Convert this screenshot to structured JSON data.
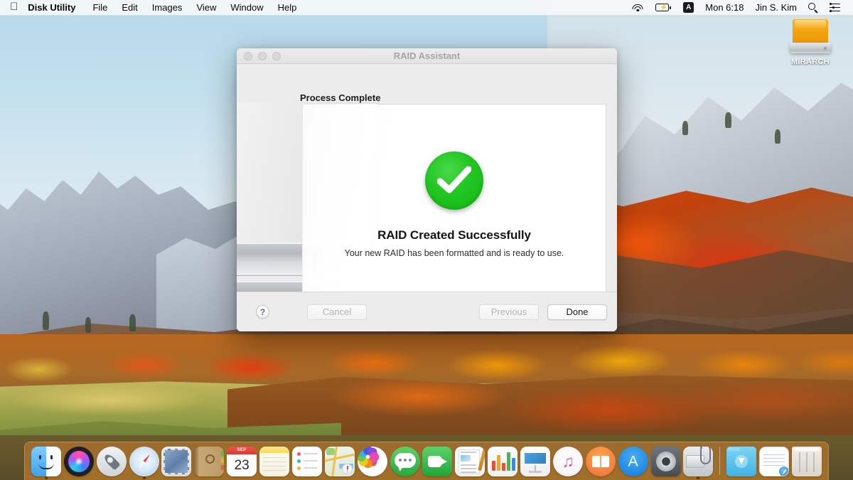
{
  "menubar": {
    "apple_icon": "apple-logo",
    "app_name": "Disk Utility",
    "items": [
      "File",
      "Edit",
      "Images",
      "View",
      "Window",
      "Help"
    ],
    "status": {
      "wifi_icon": "wifi-icon",
      "battery_icon": "battery-charging-icon",
      "input_source": "A",
      "time": "Mon 6:18",
      "user": "Jin S. Kim",
      "search_icon": "search-icon",
      "control_center_icon": "control-center-icon"
    }
  },
  "desktop": {
    "drive": {
      "label": "MIRARCH",
      "icon": "external-hard-drive-icon"
    }
  },
  "window": {
    "title": "RAID Assistant",
    "traffic_lights": [
      "close",
      "minimize",
      "zoom"
    ],
    "step_title": "Process Complete",
    "result": {
      "status_icon": "green-checkmark-icon",
      "status_color": "#22c722",
      "title": "RAID Created Successfully",
      "subtitle": "Your new RAID has been formatted and is ready to use."
    },
    "footer": {
      "help_label": "?",
      "cancel_label": "Cancel",
      "previous_label": "Previous",
      "done_label": "Done"
    }
  },
  "dock": {
    "items": [
      {
        "name": "finder",
        "label": "Finder",
        "running": true
      },
      {
        "name": "siri",
        "label": "Siri",
        "running": false
      },
      {
        "name": "launchpad",
        "label": "Launchpad",
        "running": false
      },
      {
        "name": "safari",
        "label": "Safari",
        "running": true
      },
      {
        "name": "mail",
        "label": "Mail",
        "running": false
      },
      {
        "name": "contacts",
        "label": "Contacts",
        "running": false
      },
      {
        "name": "calendar",
        "label": "Calendar",
        "running": false,
        "month": "SEP",
        "day": "23"
      },
      {
        "name": "notes",
        "label": "Notes",
        "running": false
      },
      {
        "name": "reminders",
        "label": "Reminders",
        "running": false
      },
      {
        "name": "maps",
        "label": "Maps",
        "running": false
      },
      {
        "name": "photos",
        "label": "Photos",
        "running": false
      },
      {
        "name": "messages",
        "label": "Messages",
        "running": false
      },
      {
        "name": "facetime",
        "label": "FaceTime",
        "running": false
      },
      {
        "name": "pages",
        "label": "Pages",
        "running": false
      },
      {
        "name": "numbers",
        "label": "Numbers",
        "running": false
      },
      {
        "name": "keynote",
        "label": "Keynote",
        "running": false
      },
      {
        "name": "itunes",
        "label": "iTunes",
        "running": false
      },
      {
        "name": "ibooks",
        "label": "iBooks",
        "running": false
      },
      {
        "name": "app-store",
        "label": "App Store",
        "running": false
      },
      {
        "name": "system-preferences",
        "label": "System Preferences",
        "running": false
      },
      {
        "name": "disk-utility",
        "label": "Disk Utility",
        "running": true
      }
    ],
    "right_items": [
      {
        "name": "downloads",
        "label": "Downloads"
      },
      {
        "name": "document",
        "label": "Document"
      },
      {
        "name": "trash",
        "label": "Trash"
      }
    ]
  }
}
